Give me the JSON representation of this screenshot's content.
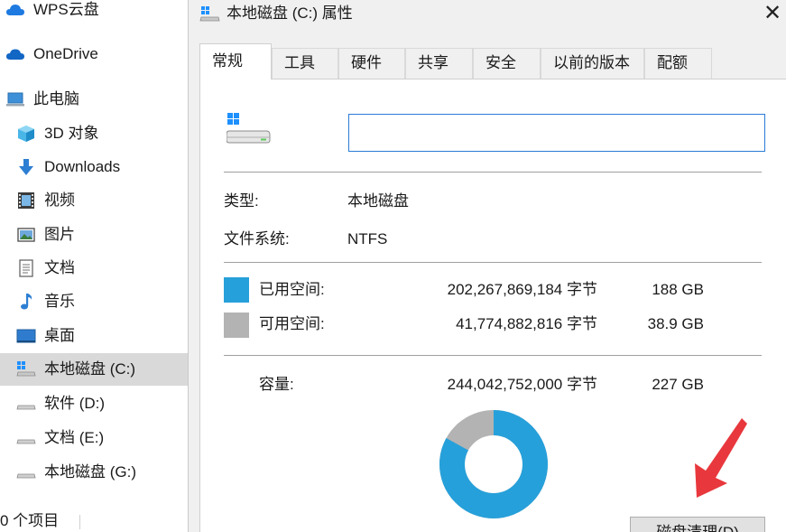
{
  "sidebar": {
    "items": [
      {
        "label": "WPS云盘",
        "icon": "cloud-icon"
      },
      {
        "label": "OneDrive",
        "icon": "onedrive-cloud-icon"
      },
      {
        "label": "此电脑",
        "icon": "computer-icon"
      },
      {
        "label": "3D 对象",
        "icon": "3d-objects-icon"
      },
      {
        "label": "Downloads",
        "icon": "download-arrow-icon"
      },
      {
        "label": "视频",
        "icon": "video-film-icon"
      },
      {
        "label": "图片",
        "icon": "picture-icon"
      },
      {
        "label": "文档",
        "icon": "document-icon"
      },
      {
        "label": "音乐",
        "icon": "music-note-icon"
      },
      {
        "label": "桌面",
        "icon": "desktop-icon"
      },
      {
        "label": "本地磁盘 (C:)",
        "icon": "windows-drive-icon"
      },
      {
        "label": "软件 (D:)",
        "icon": "drive-icon"
      },
      {
        "label": "文档 (E:)",
        "icon": "drive-icon"
      },
      {
        "label": "本地磁盘 (G:)",
        "icon": "drive-icon"
      }
    ],
    "selected_index": 10,
    "status_text": "0 个项目"
  },
  "dialog": {
    "title": "本地磁盘 (C:) 属性",
    "close_symbol": "✕",
    "tabs": [
      "常规",
      "工具",
      "硬件",
      "共享",
      "安全",
      "以前的版本",
      "配额"
    ],
    "active_tab_index": 0,
    "volume_label_value": "",
    "type_label": "类型:",
    "type_value": "本地磁盘",
    "fs_label": "文件系统:",
    "fs_value": "NTFS",
    "used_label": "已用空间:",
    "used_bytes": "202,267,869,184 字节",
    "used_size": "188 GB",
    "free_label": "可用空间:",
    "free_bytes": "41,774,882,816 字节",
    "free_size": "38.9 GB",
    "capacity_label": "容量:",
    "capacity_bytes": "244,042,752,000 字节",
    "capacity_size": "227 GB",
    "used_fraction": 0.829,
    "used_color": "#26a0da",
    "free_color": "#b3b3b3",
    "cleanup_button_label": "磁盘清理(D)",
    "annotation_color": "#e8383d"
  }
}
